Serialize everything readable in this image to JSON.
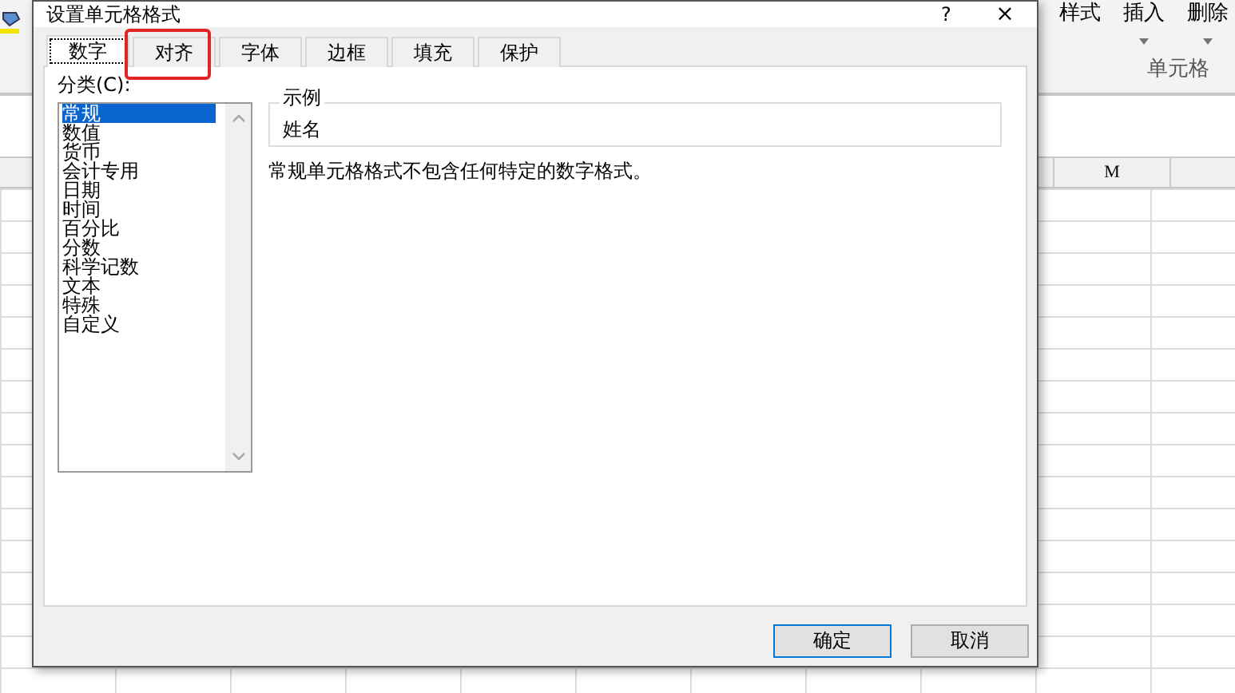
{
  "window": {
    "title": "设置单元格格式",
    "help": "?",
    "close": "×"
  },
  "tabs": [
    {
      "label": "数字",
      "selected": true,
      "highlighted": false
    },
    {
      "label": "对齐",
      "selected": false,
      "highlighted": true
    },
    {
      "label": "字体",
      "selected": false,
      "highlighted": false
    },
    {
      "label": "边框",
      "selected": false,
      "highlighted": false
    },
    {
      "label": "填充",
      "selected": false,
      "highlighted": false
    },
    {
      "label": "保护",
      "selected": false,
      "highlighted": false
    }
  ],
  "category": {
    "label": "分类(C):",
    "items": [
      {
        "label": "常规",
        "selected": true
      },
      {
        "label": "数值",
        "selected": false
      },
      {
        "label": "货币",
        "selected": false
      },
      {
        "label": "会计专用",
        "selected": false
      },
      {
        "label": "日期",
        "selected": false
      },
      {
        "label": "时间",
        "selected": false
      },
      {
        "label": "百分比",
        "selected": false
      },
      {
        "label": "分数",
        "selected": false
      },
      {
        "label": "科学记数",
        "selected": false
      },
      {
        "label": "文本",
        "selected": false
      },
      {
        "label": "特殊",
        "selected": false
      },
      {
        "label": "自定义",
        "selected": false
      }
    ]
  },
  "sample": {
    "legend": "示例",
    "value": "姓名"
  },
  "description": "常规单元格格式不包含任何特定的数字格式。",
  "buttons": [
    "确定",
    "取消"
  ],
  "spreadsheet": {
    "ribbon": {
      "buttons": [
        {
          "label": "样式",
          "dropdown": false
        },
        {
          "label": "插入",
          "dropdown": true
        },
        {
          "label": "删除",
          "dropdown": true
        }
      ],
      "group": "单元格"
    },
    "column_header": "M"
  }
}
